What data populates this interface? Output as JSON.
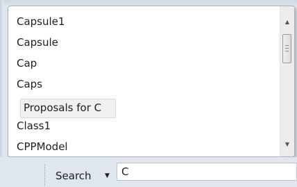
{
  "suggestions": [
    {
      "label": "Capsule1",
      "highlighted": false
    },
    {
      "label": "Capsule",
      "highlighted": false
    },
    {
      "label": "Cap",
      "highlighted": false
    },
    {
      "label": "Caps",
      "highlighted": false
    },
    {
      "label": "Proposals for C",
      "highlighted": true
    },
    {
      "label": "Class1",
      "highlighted": false
    },
    {
      "label": "CPPModel",
      "highlighted": false
    }
  ],
  "scrollbar": {
    "up_icon": "arrow-up-icon",
    "down_icon": "arrow-down-icon"
  },
  "search": {
    "label": "Search",
    "dropdown_icon": "caret-down-icon",
    "value": "C"
  }
}
